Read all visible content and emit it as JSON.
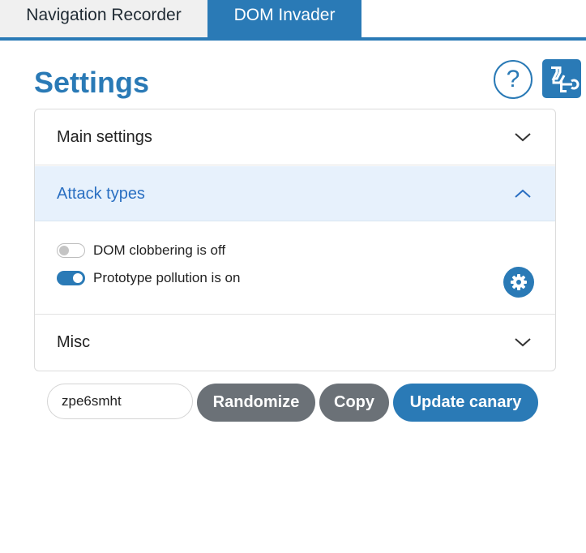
{
  "tabs": [
    {
      "label": "Navigation Recorder",
      "active": false
    },
    {
      "label": "DOM Invader",
      "active": true
    }
  ],
  "page": {
    "title": "Settings",
    "help_glyph": "?",
    "help_icon": "question-circle-icon",
    "logo_icon": "dom-invader-logo-icon"
  },
  "accordion": {
    "main_settings": {
      "label": "Main settings",
      "expanded": false
    },
    "attack_types": {
      "label": "Attack types",
      "expanded": true,
      "toggles": [
        {
          "label": "DOM clobbering is off",
          "on": false
        },
        {
          "label": "Prototype pollution is on",
          "on": true
        }
      ],
      "settings_icon": "gear-icon"
    },
    "misc": {
      "label": "Misc",
      "expanded": false
    }
  },
  "canary": {
    "value": "zpe6smht",
    "randomize_label": "Randomize",
    "copy_label": "Copy",
    "update_label": "Update canary"
  },
  "colors": {
    "accent": "#2a7ab6",
    "secondary_button": "#6b7177",
    "expanded_header_bg": "#e7f1fc",
    "expanded_header_text": "#2a6fc2"
  }
}
